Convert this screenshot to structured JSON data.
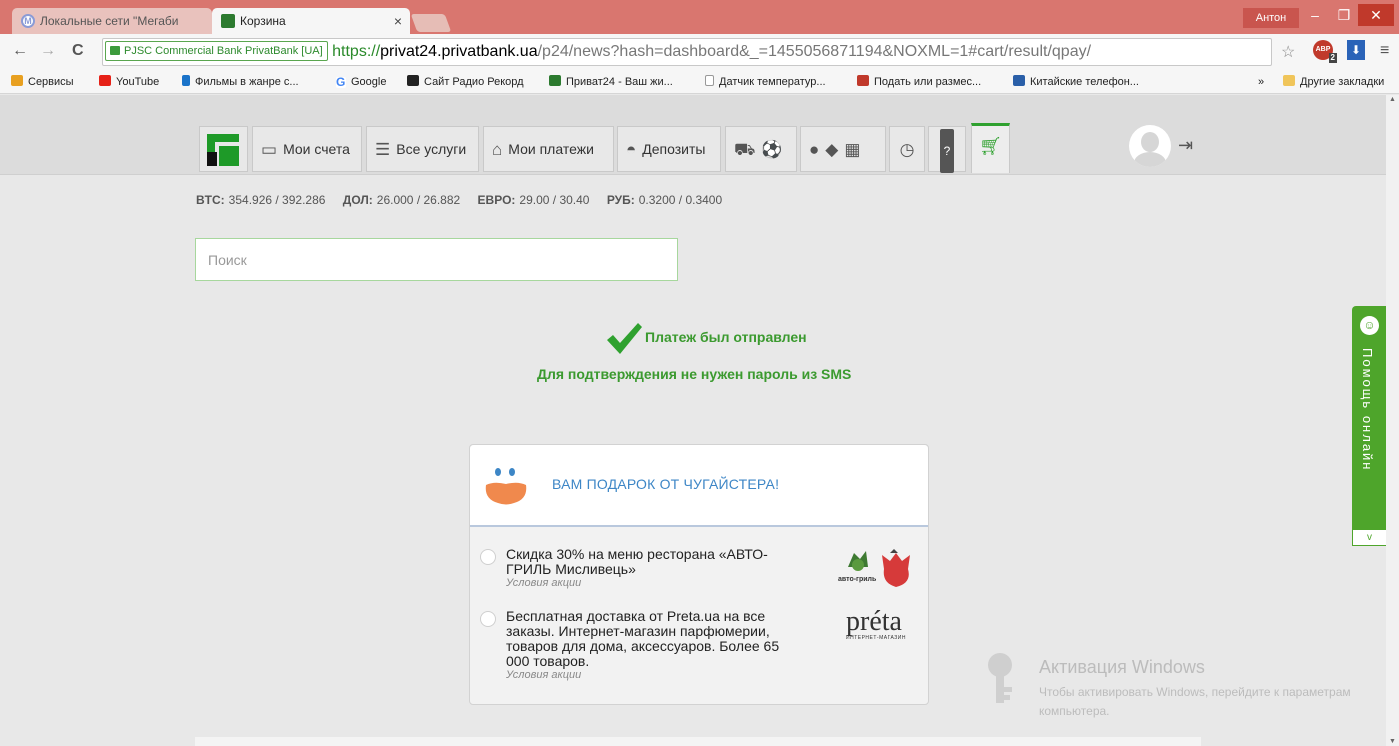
{
  "browser": {
    "tabs": [
      {
        "title": "Локальные сети \"Мегаби",
        "active": false
      },
      {
        "title": "Корзина",
        "active": true
      }
    ],
    "user": "Антон",
    "address": {
      "ev_label": "PJSC Commercial Bank PrivatBank [UA]",
      "scheme": "https://",
      "host": "privat24.privatbank.ua",
      "path": "/p24/news?hash=dashboard&_=1455056871194&NOXML=1#cart/result/qpay/"
    },
    "extensions": {
      "abp_badge": "2"
    },
    "bookmarks": [
      {
        "label": "Сервисы",
        "icon": "apps-icon",
        "color": "#e8a020"
      },
      {
        "label": "YouTube",
        "icon": "youtube-icon",
        "color": "#e62117"
      },
      {
        "label": "Фильмы в жанре с...",
        "icon": "arrow-up-icon",
        "color": "#1a73c9"
      },
      {
        "label": "Google",
        "icon": "google-icon",
        "color": "#4285f4"
      },
      {
        "label": "Сайт Радио Рекорд",
        "icon": "record-icon",
        "color": "#222222"
      },
      {
        "label": "Приват24 - Ваш жи...",
        "icon": "privat-icon",
        "color": "#2c7a2f"
      },
      {
        "label": "Датчик температур...",
        "icon": "page-icon",
        "color": "#999999"
      },
      {
        "label": "Подать или размес...",
        "icon": "olx-icon",
        "color": "#c0392b"
      },
      {
        "label": "Китайские телефон...",
        "icon": "phone-icon",
        "color": "#2a5fa8"
      }
    ],
    "bookmarks_more": "»",
    "other_bookmarks": "Другие закладки"
  },
  "nav": {
    "accounts": "Мои счета",
    "services": "Все услуги",
    "payments": "Мои платежи",
    "deposits": "Депозиты"
  },
  "rates": [
    {
      "label": "BTC:",
      "value": "354.926 / 392.286"
    },
    {
      "label": "ДОЛ:",
      "value": "26.000 / 26.882"
    },
    {
      "label": "ЕВРО:",
      "value": "29.00 / 30.40"
    },
    {
      "label": "РУБ:",
      "value": "0.3200 / 0.3400"
    }
  ],
  "search": {
    "placeholder": "Поиск"
  },
  "result": {
    "title": "Платеж был отправлен",
    "subtitle": "Для подтверждения не нужен пароль из SMS"
  },
  "gift": {
    "title": "ВАМ ПОДАРОК ОТ ЧУГАЙСТЕРА!",
    "offers": [
      {
        "text": "Скидка 30% на меню ресторана «АВТО-ГРИЛЬ Мисливець»",
        "conditions": "Условия акции",
        "brand": "авто-гриль"
      },
      {
        "text": "Бесплатная доставка от Preta.ua на все заказы. Интернет-магазин парфюмерии, товаров для дома, аксессуаров. Более 65 000 товаров.",
        "conditions": "Условия акции",
        "brand": "préta",
        "brand_sub": "ИНТЕРНЕТ-МАГАЗИН"
      }
    ]
  },
  "help": {
    "label": "Помощь онлайн",
    "arrow": "v"
  },
  "windows_activation": {
    "title": "Активация Windows",
    "text": "Чтобы активировать Windows, перейдите к параметрам компьютера."
  },
  "colors": {
    "brand_green": "#1e9a28",
    "success_green": "#3b9a2f",
    "gift_blue": "#3d86c6",
    "help_green": "#4ea52b"
  }
}
